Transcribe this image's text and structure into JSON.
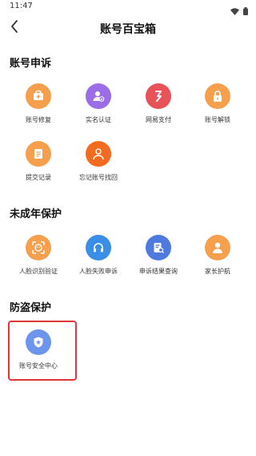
{
  "status_bar": {
    "time": "11:47",
    "icons": [
      "wifi-icon",
      "battery-icon"
    ]
  },
  "nav": {
    "back_icon": "chevron-left-icon",
    "title": "账号百宝箱"
  },
  "sections": [
    {
      "title": "账号申诉",
      "items": [
        {
          "label": "账号修复",
          "icon": "shield-plus-icon",
          "color": "#f6a04d"
        },
        {
          "label": "实名认证",
          "icon": "user-check-icon",
          "color": "#9b6ee8"
        },
        {
          "label": "网易支付",
          "icon": "payment-icon",
          "color": "#e8535a"
        },
        {
          "label": "账号解锁",
          "icon": "unlock-icon",
          "color": "#f6a04d"
        },
        {
          "label": "提交记录",
          "icon": "document-icon",
          "color": "#f6a04d"
        },
        {
          "label": "忘记账号找回",
          "icon": "user-search-icon",
          "color": "#f46a1e"
        }
      ]
    },
    {
      "title": "未成年保护",
      "items": [
        {
          "label": "人脸识别验证",
          "icon": "face-scan-icon",
          "color": "#f6a04d"
        },
        {
          "label": "人脸失败申诉",
          "icon": "headset-icon",
          "color": "#3a8ee6"
        },
        {
          "label": "申诉结果查询",
          "icon": "search-document-icon",
          "color": "#4e7ae0"
        },
        {
          "label": "家长护航",
          "icon": "parent-icon",
          "color": "#f6a04d"
        }
      ]
    },
    {
      "title": "防盗保护",
      "items": [
        {
          "label": "账号安全中心",
          "icon": "shield-star-icon",
          "color": "#6c96ee"
        }
      ]
    }
  ],
  "colors": {
    "highlight_border": "#e0363a"
  }
}
